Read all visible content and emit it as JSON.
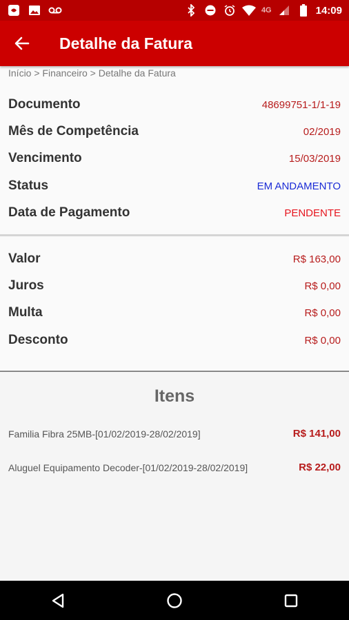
{
  "status_bar": {
    "network": "4G",
    "time": "14:09"
  },
  "app_bar": {
    "title": "Detalhe da Fatura"
  },
  "breadcrumb": "Início > Financeiro > Detalhe da Fatura",
  "details": [
    {
      "label": "Documento",
      "value": "48699751-1/1-19"
    },
    {
      "label": "Mês de Competência",
      "value": "02/2019"
    },
    {
      "label": "Vencimento",
      "value": "15/03/2019"
    },
    {
      "label": "Status",
      "value": "EM ANDAMENTO"
    },
    {
      "label": "Data de Pagamento",
      "value": "PENDENTE"
    }
  ],
  "amounts": [
    {
      "label": "Valor",
      "value": "R$ 163,00"
    },
    {
      "label": "Juros",
      "value": "R$ 0,00"
    },
    {
      "label": "Multa",
      "value": "R$ 0,00"
    },
    {
      "label": "Desconto",
      "value": "R$ 0,00"
    }
  ],
  "items_section": {
    "title": "Itens",
    "items": [
      {
        "description": "Familia Fibra 25MB-[01/02/2019-28/02/2019]",
        "price": "R$ 141,00"
      },
      {
        "description": "Aluguel Equipamento Decoder-[01/02/2019-28/02/2019]",
        "price": "R$ 22,00"
      }
    ]
  },
  "colors": {
    "app_bar": "#cc0000",
    "status_bar": "#b60000",
    "value_red": "#b71c1c",
    "status_blue": "#1a2bd6",
    "pending_red": "#e6151e"
  }
}
